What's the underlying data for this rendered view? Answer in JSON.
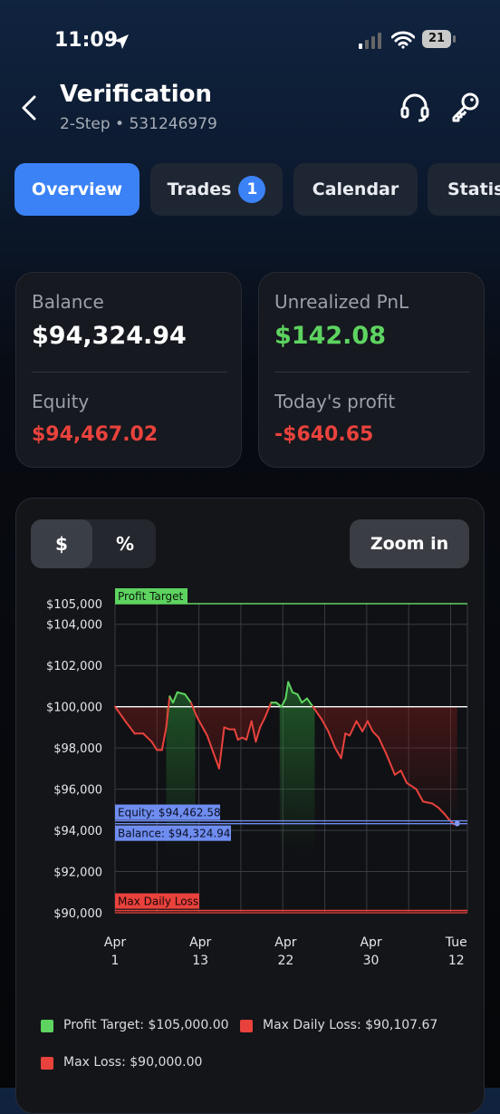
{
  "status": {
    "time": "11:09",
    "battery": "21"
  },
  "header": {
    "title": "Verification",
    "subtitle": "2-Step • 531246979"
  },
  "tabs": [
    {
      "label": "Overview"
    },
    {
      "label": "Trades",
      "badge": "1"
    },
    {
      "label": "Calendar"
    },
    {
      "label": "Statist"
    }
  ],
  "summary": {
    "balance_label": "Balance",
    "balance_value": "$94,324.94",
    "equity_label": "Equity",
    "equity_value": "$94,467.02",
    "unrealized_label": "Unrealized PnL",
    "unrealized_value": "$142.08",
    "today_label": "Today's profit",
    "today_value": "-$640.65"
  },
  "controls": {
    "dollar": "$",
    "percent": "%",
    "zoom": "Zoom in"
  },
  "colors": {
    "green": "#5ed460",
    "red": "#e9423d",
    "blue": "#6f8df0",
    "accent": "#3b82f6"
  },
  "chart_data": {
    "type": "line",
    "ylim": [
      90000,
      105000
    ],
    "yticks": [
      {
        "value": 105000,
        "label": "$105,000"
      },
      {
        "value": 104000,
        "label": "$104,000"
      },
      {
        "value": 102000,
        "label": "$102,000"
      },
      {
        "value": 100000,
        "label": "$100,000"
      },
      {
        "value": 98000,
        "label": "$98,000"
      },
      {
        "value": 96000,
        "label": "$96,000"
      },
      {
        "value": 94000,
        "label": "$94,000"
      },
      {
        "value": 92000,
        "label": "$92,000"
      },
      {
        "value": 90000,
        "label": "$90,000"
      }
    ],
    "xticks": [
      {
        "idx": 0,
        "line1": "Apr",
        "line2": "1"
      },
      {
        "idx": 10,
        "line1": "Apr",
        "line2": "13"
      },
      {
        "idx": 20,
        "line1": "Apr",
        "line2": "22"
      },
      {
        "idx": 30,
        "line1": "Apr",
        "line2": "30"
      },
      {
        "idx": 40,
        "line1": "Tue",
        "line2": "12"
      }
    ],
    "reference_lines": [
      {
        "label": "Profit Target",
        "value": 105000,
        "color": "#5ed460"
      },
      {
        "label": "Equity: $94,462.58",
        "value": 94462.58,
        "color": "#6f8df0"
      },
      {
        "label": "Balance: $94,324.94",
        "value": 94324.94,
        "color": "#6f8df0"
      },
      {
        "label": "Max Daily Loss",
        "value": 90107.67,
        "color": "#e9423d"
      }
    ],
    "baseline": 100000,
    "series": [
      {
        "values": [
          [
            0,
            100000
          ],
          [
            1.2,
            99300
          ],
          [
            2.3,
            98700
          ],
          [
            3.3,
            98700
          ],
          [
            4.3,
            98300
          ],
          [
            4.9,
            97900
          ],
          [
            5.5,
            97900
          ],
          [
            6.0,
            99000
          ],
          [
            6.4,
            100500
          ],
          [
            6.8,
            100200
          ],
          [
            7.3,
            100700
          ],
          [
            8.2,
            100600
          ],
          [
            8.9,
            100200
          ],
          [
            9.6,
            99500
          ],
          [
            10.8,
            98600
          ],
          [
            11.5,
            97800
          ],
          [
            12.2,
            97000
          ],
          [
            12.8,
            99000
          ],
          [
            13.4,
            98900
          ],
          [
            14.0,
            98900
          ],
          [
            14.4,
            98400
          ],
          [
            14.9,
            98500
          ],
          [
            15.4,
            98400
          ],
          [
            16.0,
            99300
          ],
          [
            16.5,
            98300
          ],
          [
            17.0,
            99000
          ],
          [
            17.6,
            99500
          ],
          [
            18.3,
            100200
          ],
          [
            18.9,
            100200
          ],
          [
            19.5,
            100000
          ],
          [
            20.0,
            100400
          ],
          [
            20.3,
            101200
          ],
          [
            20.8,
            100700
          ],
          [
            21.4,
            100600
          ],
          [
            21.9,
            100200
          ],
          [
            22.5,
            100400
          ],
          [
            23.2,
            100000
          ],
          [
            24.2,
            99400
          ],
          [
            25.0,
            98800
          ],
          [
            25.8,
            98000
          ],
          [
            26.5,
            97500
          ],
          [
            27.0,
            98700
          ],
          [
            27.5,
            98600
          ],
          [
            28.3,
            99300
          ],
          [
            29.0,
            98800
          ],
          [
            29.6,
            99300
          ],
          [
            30.2,
            98800
          ],
          [
            30.9,
            98500
          ],
          [
            31.8,
            97700
          ],
          [
            32.8,
            96700
          ],
          [
            33.5,
            96900
          ],
          [
            34.2,
            96300
          ],
          [
            35.3,
            96000
          ],
          [
            36.1,
            95400
          ],
          [
            37.2,
            95300
          ],
          [
            37.9,
            95100
          ],
          [
            38.6,
            94800
          ],
          [
            39.2,
            94500
          ],
          [
            39.7,
            94300
          ],
          [
            40.1,
            94330
          ]
        ]
      }
    ],
    "legend": [
      {
        "label": "Profit Target: $105,000.00",
        "color": "#5ed460"
      },
      {
        "label": "Max Daily Loss: $90,107.67",
        "color": "#e9423d"
      },
      {
        "label": "Max Loss: $90,000.00",
        "color": "#e9423d"
      }
    ]
  }
}
